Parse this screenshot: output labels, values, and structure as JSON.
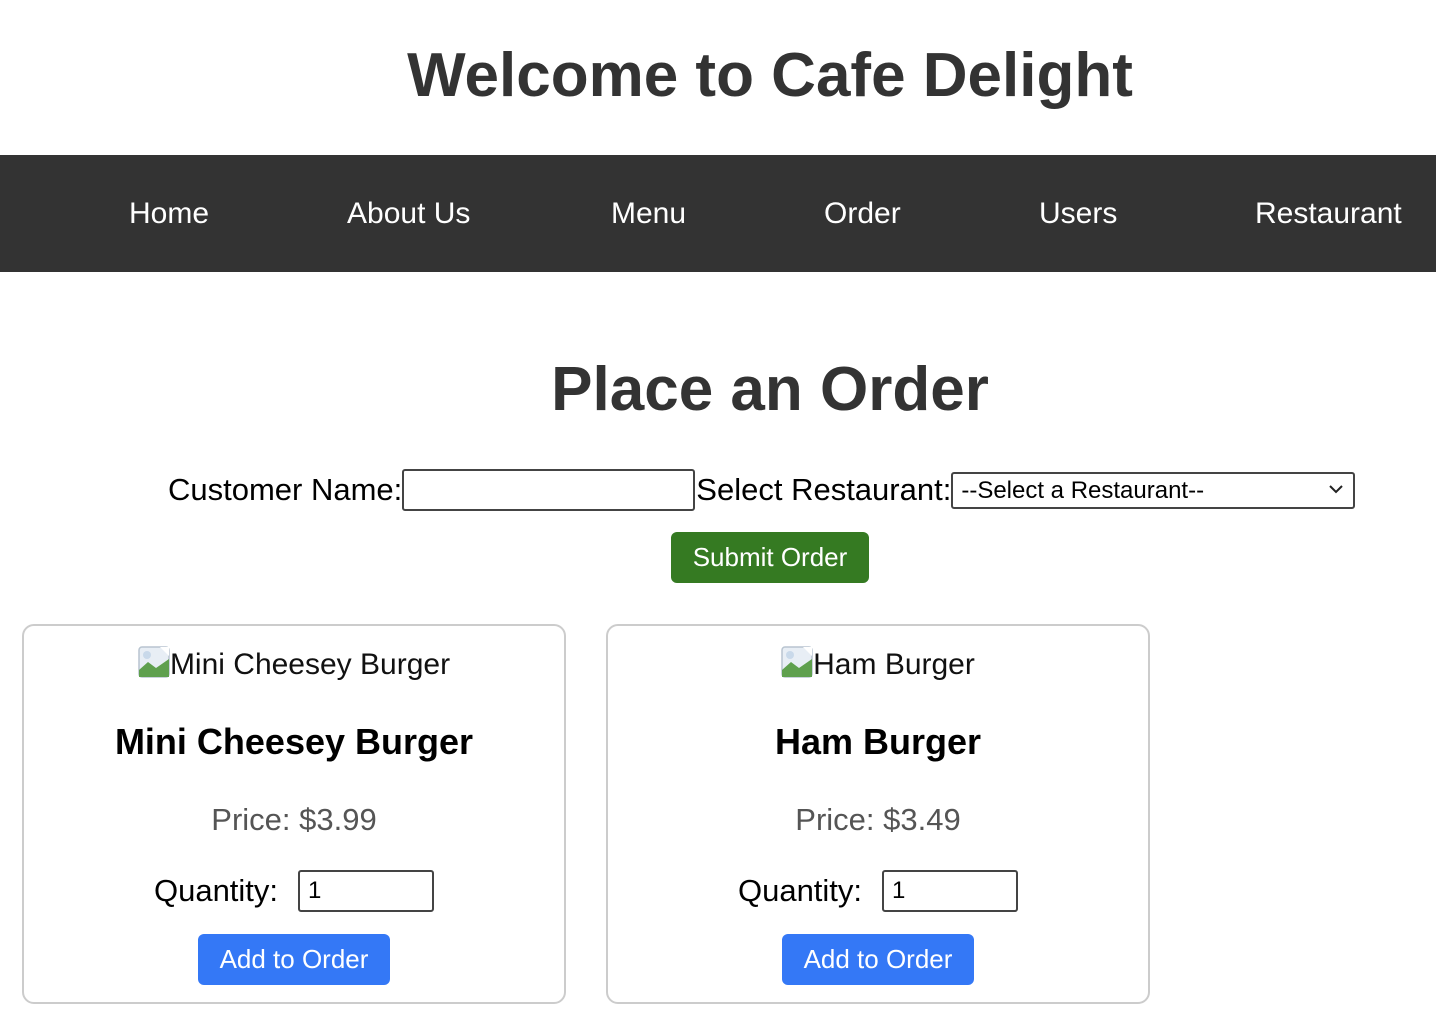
{
  "header": {
    "title": "Welcome to Cafe Delight"
  },
  "nav": {
    "items": [
      {
        "label": "Home"
      },
      {
        "label": "About Us"
      },
      {
        "label": "Menu"
      },
      {
        "label": "Order"
      },
      {
        "label": "Users"
      },
      {
        "label": "Restaurant"
      }
    ]
  },
  "order_form": {
    "heading": "Place an Order",
    "customer_name_label": "Customer Name:",
    "customer_name_value": "",
    "restaurant_label": "Select Restaurant:",
    "restaurant_selected": "--Select a Restaurant--",
    "submit_label": "Submit Order"
  },
  "menu_items": [
    {
      "image_alt": "Mini Cheesey Burger",
      "name": "Mini Cheesey Burger",
      "price": "Price: $3.99",
      "quantity_label": "Quantity:",
      "quantity_value": "1",
      "add_label": "Add to Order"
    },
    {
      "image_alt": "Ham Burger",
      "name": "Ham Burger",
      "price": "Price: $3.49",
      "quantity_label": "Quantity:",
      "quantity_value": "1",
      "add_label": "Add to Order"
    }
  ],
  "colors": {
    "nav_bg": "#333333",
    "submit_bg": "#357a22",
    "add_bg": "#3478f6",
    "text_dark": "#333333",
    "price_text": "#555555"
  }
}
